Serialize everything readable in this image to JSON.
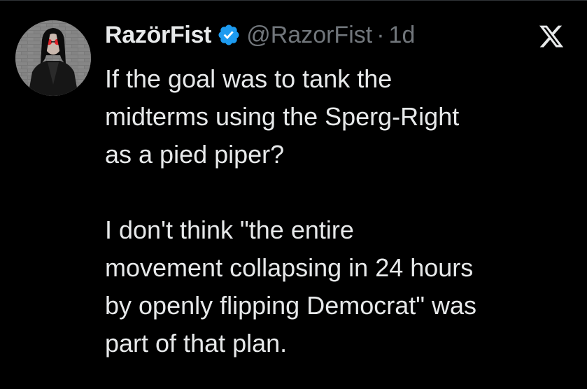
{
  "tweet": {
    "display_name": "RazörFist",
    "verified_icon": "verified-badge-icon",
    "handle": "@RazorFist",
    "separator": "·",
    "time": "1d",
    "platform_icon": "x-logo-icon",
    "paragraphs": [
      [
        "If the goal was to tank the",
        "midterms using the Sperg-Right",
        "as a pied piper?"
      ],
      [
        "I don't think \"the entire",
        "movement collapsing in 24 hours",
        "by openly flipping Democrat\" was",
        "part of that plan."
      ]
    ]
  },
  "colors": {
    "background": "#000000",
    "text": "#e7e9ea",
    "secondary": "#71767b",
    "verified": "#1d9bf0"
  }
}
